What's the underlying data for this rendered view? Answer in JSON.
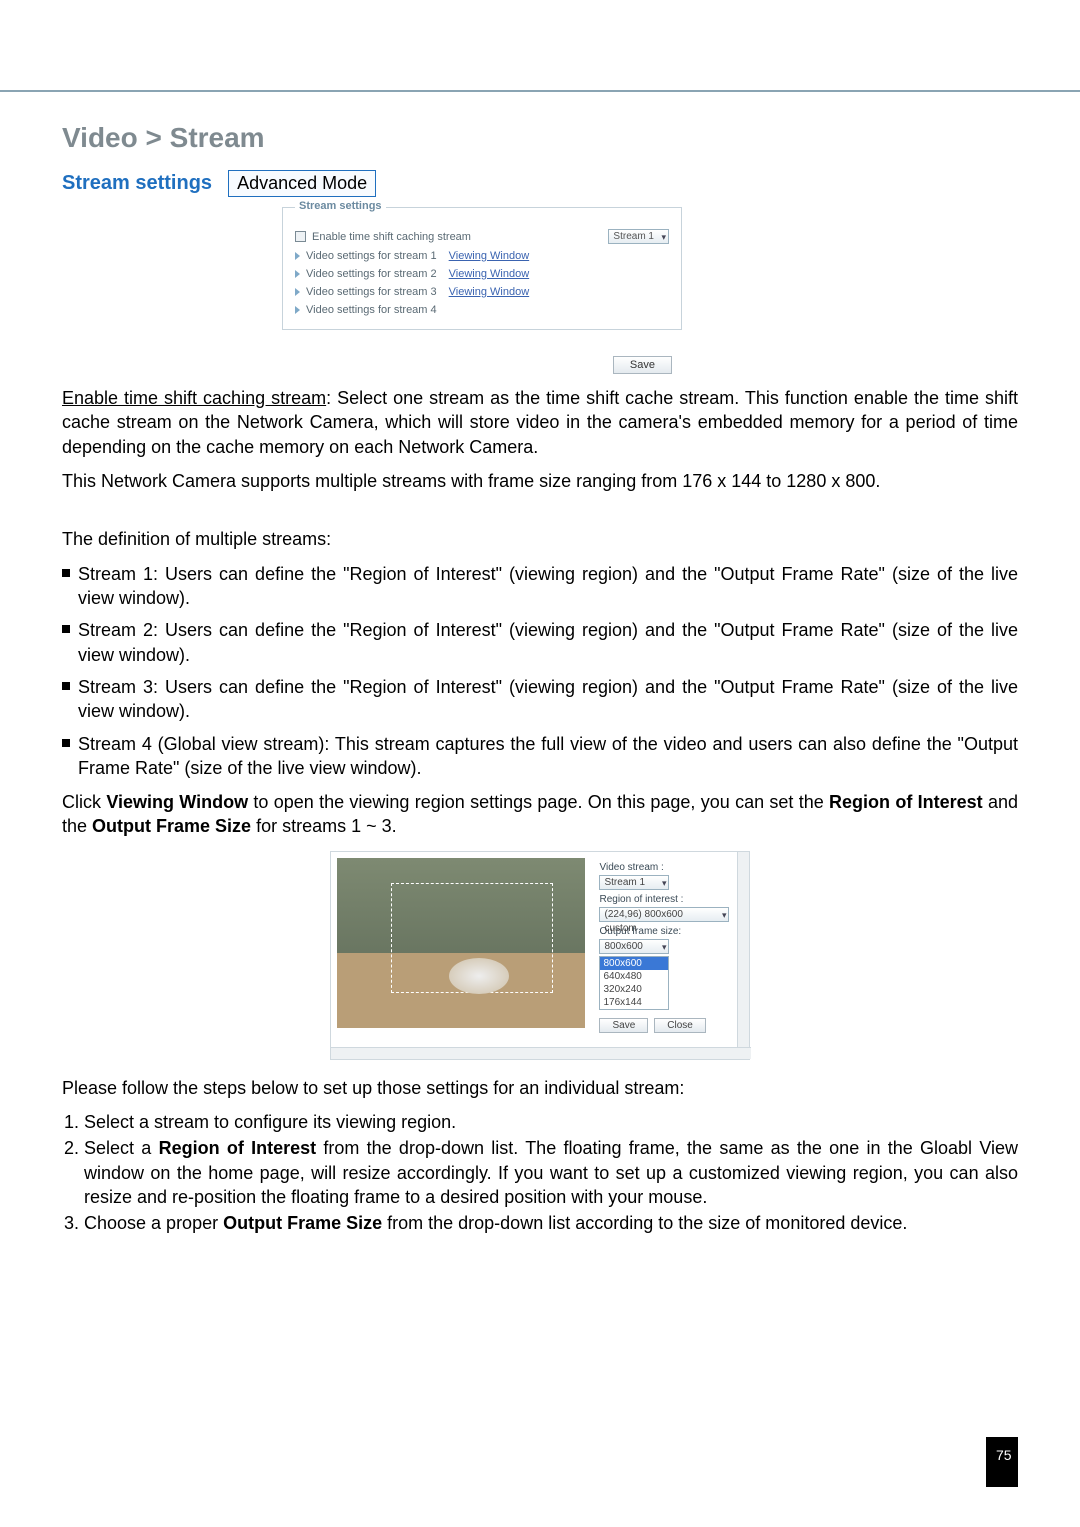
{
  "breadcrumb": "Video > Stream",
  "stream_settings_label": "Stream settings",
  "advanced_mode": "Advanced Mode",
  "panel1": {
    "legend": "Stream settings",
    "enable_label": "Enable time shift caching stream",
    "stream_dd": "Stream 1",
    "row1": "Video settings for stream 1",
    "row2": "Video settings for stream 2",
    "row3": "Video settings for stream 3",
    "row4": "Video settings for stream 4",
    "vw": "Viewing Window",
    "save": "Save"
  },
  "para1_u": "Enable time shift caching stream",
  "para1_rest": ": Select one stream as the time shift cache stream. This function enable the time shift cache stream on the Network Camera, which will store video in the camera's embedded memory for a period of time depending on the cache memory on each Network Camera.",
  "para2": "This Network Camera supports multiple streams with frame size ranging from 176 x 144 to 1280 x 800.",
  "def_head": "The definition of multiple streams:",
  "bullets": {
    "b1": "Stream 1: Users can define the \"Region of Interest\" (viewing region) and the \"Output Frame Rate\" (size of the live view window).",
    "b2": "Stream 2: Users can define the \"Region of Interest\" (viewing region) and the \"Output Frame Rate\" (size of the live view window).",
    "b3": "Stream 3: Users can define the \"Region of Interest\" (viewing region) and the \"Output Frame Rate\" (size of the live view window).",
    "b4": "Stream 4 (Global view stream): This stream captures the full view of the video and users can also define the \"Output Frame Rate\" (size of the live view window)."
  },
  "para3_pre": "Click ",
  "para3_b1": "Viewing Window",
  "para3_mid": " to open the viewing region settings page. On this page, you can set the ",
  "para3_b2": "Region of Interest",
  "para3_mid2": " and the ",
  "para3_b3": "Output Frame Size",
  "para3_end": " for streams 1 ~ 3.",
  "panel2": {
    "vs_label": "Video stream :",
    "vs_dd": "Stream 1",
    "roi_label": "Region of interest :",
    "roi_dd": "(224,96) 800x600 custom",
    "ofs_label": "Output frame size:",
    "ofs_dd": "800x600",
    "opts": [
      "800x600",
      "640x480",
      "320x240",
      "176x144"
    ],
    "save": "Save",
    "close": "Close"
  },
  "steps_intro": "Please follow the steps below to set up those settings for an individual stream:",
  "steps": {
    "s1": "Select a stream to configure its viewing region.",
    "s2a": "Select a ",
    "s2b": "Region of Interest",
    "s2c": " from the drop-down list. The floating frame, the same as the one in the Gloabl View window on the home page, will resize accordingly. If you want to set up a customized viewing region, you can also resize and re-position the floating frame to a desired position with your mouse.",
    "s3a": "Choose a proper ",
    "s3b": "Output Frame Size",
    "s3c": " from the drop-down list according to the size of monitored device."
  },
  "page_num": "75"
}
